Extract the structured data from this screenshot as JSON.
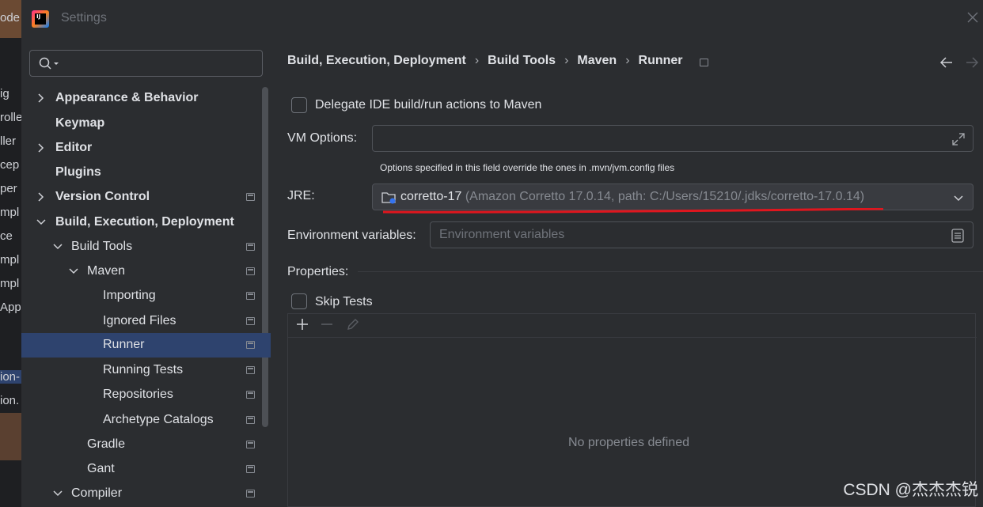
{
  "background": {
    "fragments": [
      "ode",
      "ig",
      "rolle",
      "ller",
      "cep",
      "per",
      "mpl",
      "ce",
      "mpl",
      "mpl",
      "Appl",
      "ion-",
      "ion."
    ]
  },
  "window": {
    "title": "Settings"
  },
  "sidebar": {
    "search_placeholder": "",
    "items": [
      {
        "label": "Appearance & Behavior"
      },
      {
        "label": "Keymap"
      },
      {
        "label": "Editor"
      },
      {
        "label": "Plugins"
      },
      {
        "label": "Version Control"
      },
      {
        "label": "Build, Execution, Deployment"
      },
      {
        "label": "Build Tools"
      },
      {
        "label": "Maven"
      },
      {
        "label": "Importing"
      },
      {
        "label": "Ignored Files"
      },
      {
        "label": "Runner"
      },
      {
        "label": "Running Tests"
      },
      {
        "label": "Repositories"
      },
      {
        "label": "Archetype Catalogs"
      },
      {
        "label": "Gradle"
      },
      {
        "label": "Gant"
      },
      {
        "label": "Compiler"
      }
    ]
  },
  "breadcrumb": [
    "Build, Execution, Deployment",
    "Build Tools",
    "Maven",
    "Runner"
  ],
  "breadcrumb_separator": "›",
  "runner": {
    "delegate_label": "Delegate IDE build/run actions to Maven",
    "vm_options_label": "VM Options:",
    "vm_options_value": "",
    "vm_options_hint": "Options specified in this field override the ones in .mvn/jvm.config files",
    "jre_label": "JRE:",
    "jre_name": "corretto-17",
    "jre_detail": "(Amazon Corretto 17.0.14, path: C:/Users/15210/.jdks/corretto-17.0.14)",
    "env_label": "Environment variables:",
    "env_placeholder": "Environment variables",
    "properties_label": "Properties:",
    "skip_tests_label": "Skip Tests",
    "no_properties": "No properties defined"
  },
  "watermark": "CSDN @杰杰杰锐",
  "colors": {
    "background": "#2b2d30",
    "selection": "#2e436e",
    "accent_underline": "#e0161e"
  }
}
